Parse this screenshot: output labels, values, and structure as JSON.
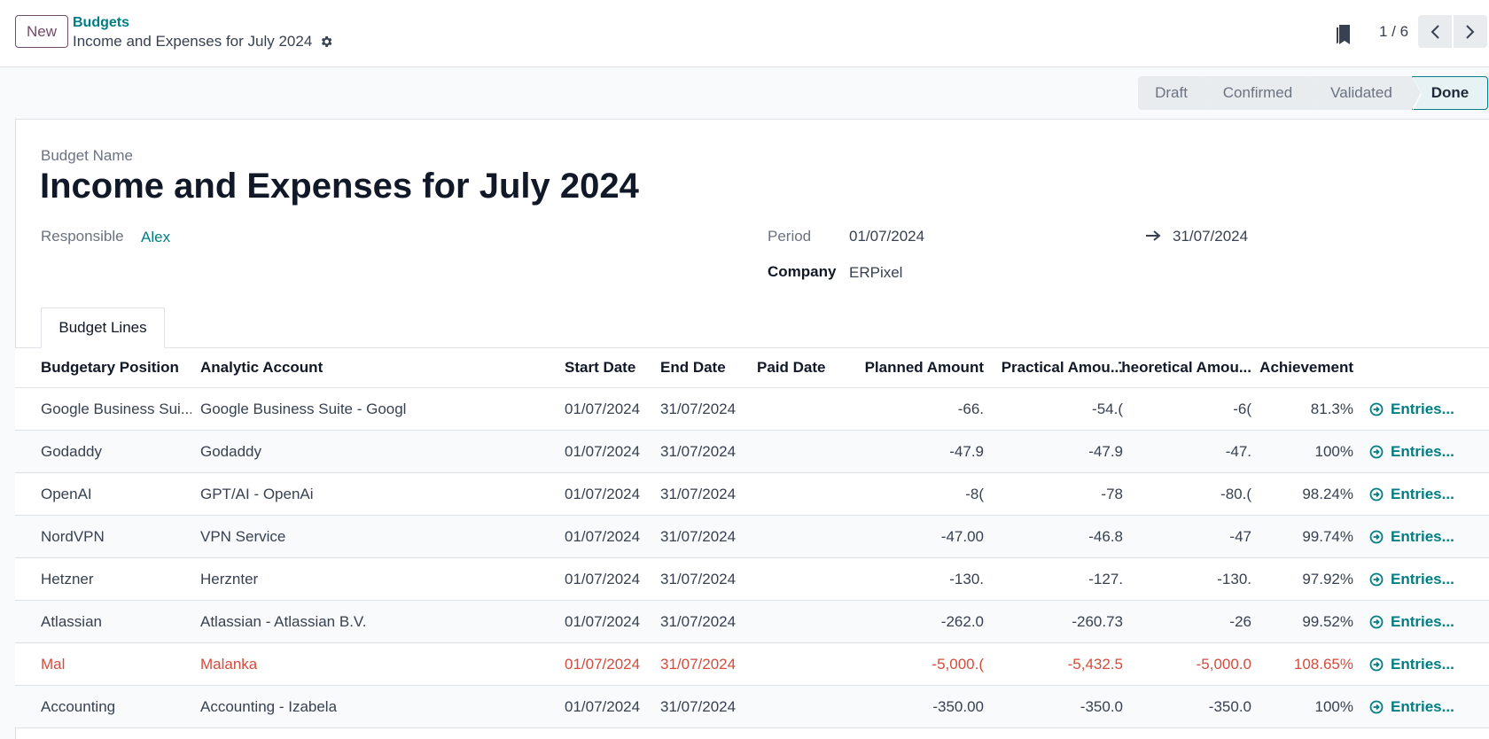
{
  "control_panel": {
    "new_label": "New",
    "breadcrumb_parent": "Budgets",
    "breadcrumb_current": "Income and Expenses for July 2024",
    "pager_value": "1 / 6"
  },
  "statusbar": {
    "stages": [
      "Draft",
      "Confirmed",
      "Validated",
      "Done"
    ],
    "current": "Done"
  },
  "form": {
    "name_label": "Budget Name",
    "name": "Income and Expenses for July 2024",
    "responsible_label": "Responsible",
    "responsible": "Alex",
    "period_label": "Period",
    "period_start": "01/07/2024",
    "period_end": "31/07/2024",
    "company_label": "Company",
    "company": "ERPixel"
  },
  "tabs": {
    "budget_lines": "Budget Lines"
  },
  "table": {
    "headers": {
      "budgetary_position": "Budgetary Position",
      "analytic_account": "Analytic Account",
      "start_date": "Start Date",
      "end_date": "End Date",
      "paid_date": "Paid Date",
      "planned": "Planned Amount",
      "practical": "Practical Amou...",
      "theoretical": "Theoretical Amou...",
      "achievement": "Achievement"
    },
    "rows": [
      {
        "bp": "Google Business Sui...",
        "aa": "Google Business Suite - Googl",
        "start": "01/07/2024",
        "end": "31/07/2024",
        "paid": "",
        "planned": "-66.",
        "practical": "-54.(",
        "theoretical": "-6(",
        "achievement": "81.3%",
        "entries": "Entries..."
      },
      {
        "bp": "Godaddy",
        "aa": "Godaddy",
        "start": "01/07/2024",
        "end": "31/07/2024",
        "paid": "",
        "planned": "-47.9",
        "practical": "-47.9",
        "theoretical": "-47.",
        "achievement": "100%",
        "entries": "Entries..."
      },
      {
        "bp": "OpenAI",
        "aa": "GPT/AI - OpenAi",
        "start": "01/07/2024",
        "end": "31/07/2024",
        "paid": "",
        "planned": "-8(",
        "practical": "-78",
        "theoretical": "-80.(",
        "achievement": "98.24%",
        "entries": "Entries..."
      },
      {
        "bp": "NordVPN",
        "aa": "VPN Service",
        "start": "01/07/2024",
        "end": "31/07/2024",
        "paid": "",
        "planned": "-47.00",
        "practical": "-46.8",
        "theoretical": "-47",
        "achievement": "99.74%",
        "entries": "Entries..."
      },
      {
        "bp": "Hetzner",
        "aa": "Herznter",
        "start": "01/07/2024",
        "end": "31/07/2024",
        "paid": "",
        "planned": "-130.",
        "practical": "-127.",
        "theoretical": "-130.",
        "achievement": "97.92%",
        "entries": "Entries..."
      },
      {
        "bp": "Atlassian",
        "aa": "Atlassian - Atlassian B.V.",
        "start": "01/07/2024",
        "end": "31/07/2024",
        "paid": "",
        "planned": "-262.0",
        "practical": "-260.73",
        "theoretical": "-26",
        "achievement": "99.52%",
        "entries": "Entries..."
      },
      {
        "bp": "Mal",
        "aa": "Malanka",
        "start": "01/07/2024",
        "end": "31/07/2024",
        "paid": "",
        "planned": "-5,000.(",
        "practical": "-5,432.5",
        "theoretical": "-5,000.0",
        "achievement": "108.65%",
        "entries": "Entries...",
        "danger": true
      },
      {
        "bp": "Accounting",
        "aa": "Accounting - Izabela",
        "start": "01/07/2024",
        "end": "31/07/2024",
        "paid": "",
        "planned": "-350.00",
        "practical": "-350.0",
        "theoretical": "-350.0",
        "achievement": "100%",
        "entries": "Entries..."
      }
    ]
  },
  "colors": {
    "brand": "#714b67",
    "link": "#017e84",
    "danger": "#d44c3c"
  }
}
